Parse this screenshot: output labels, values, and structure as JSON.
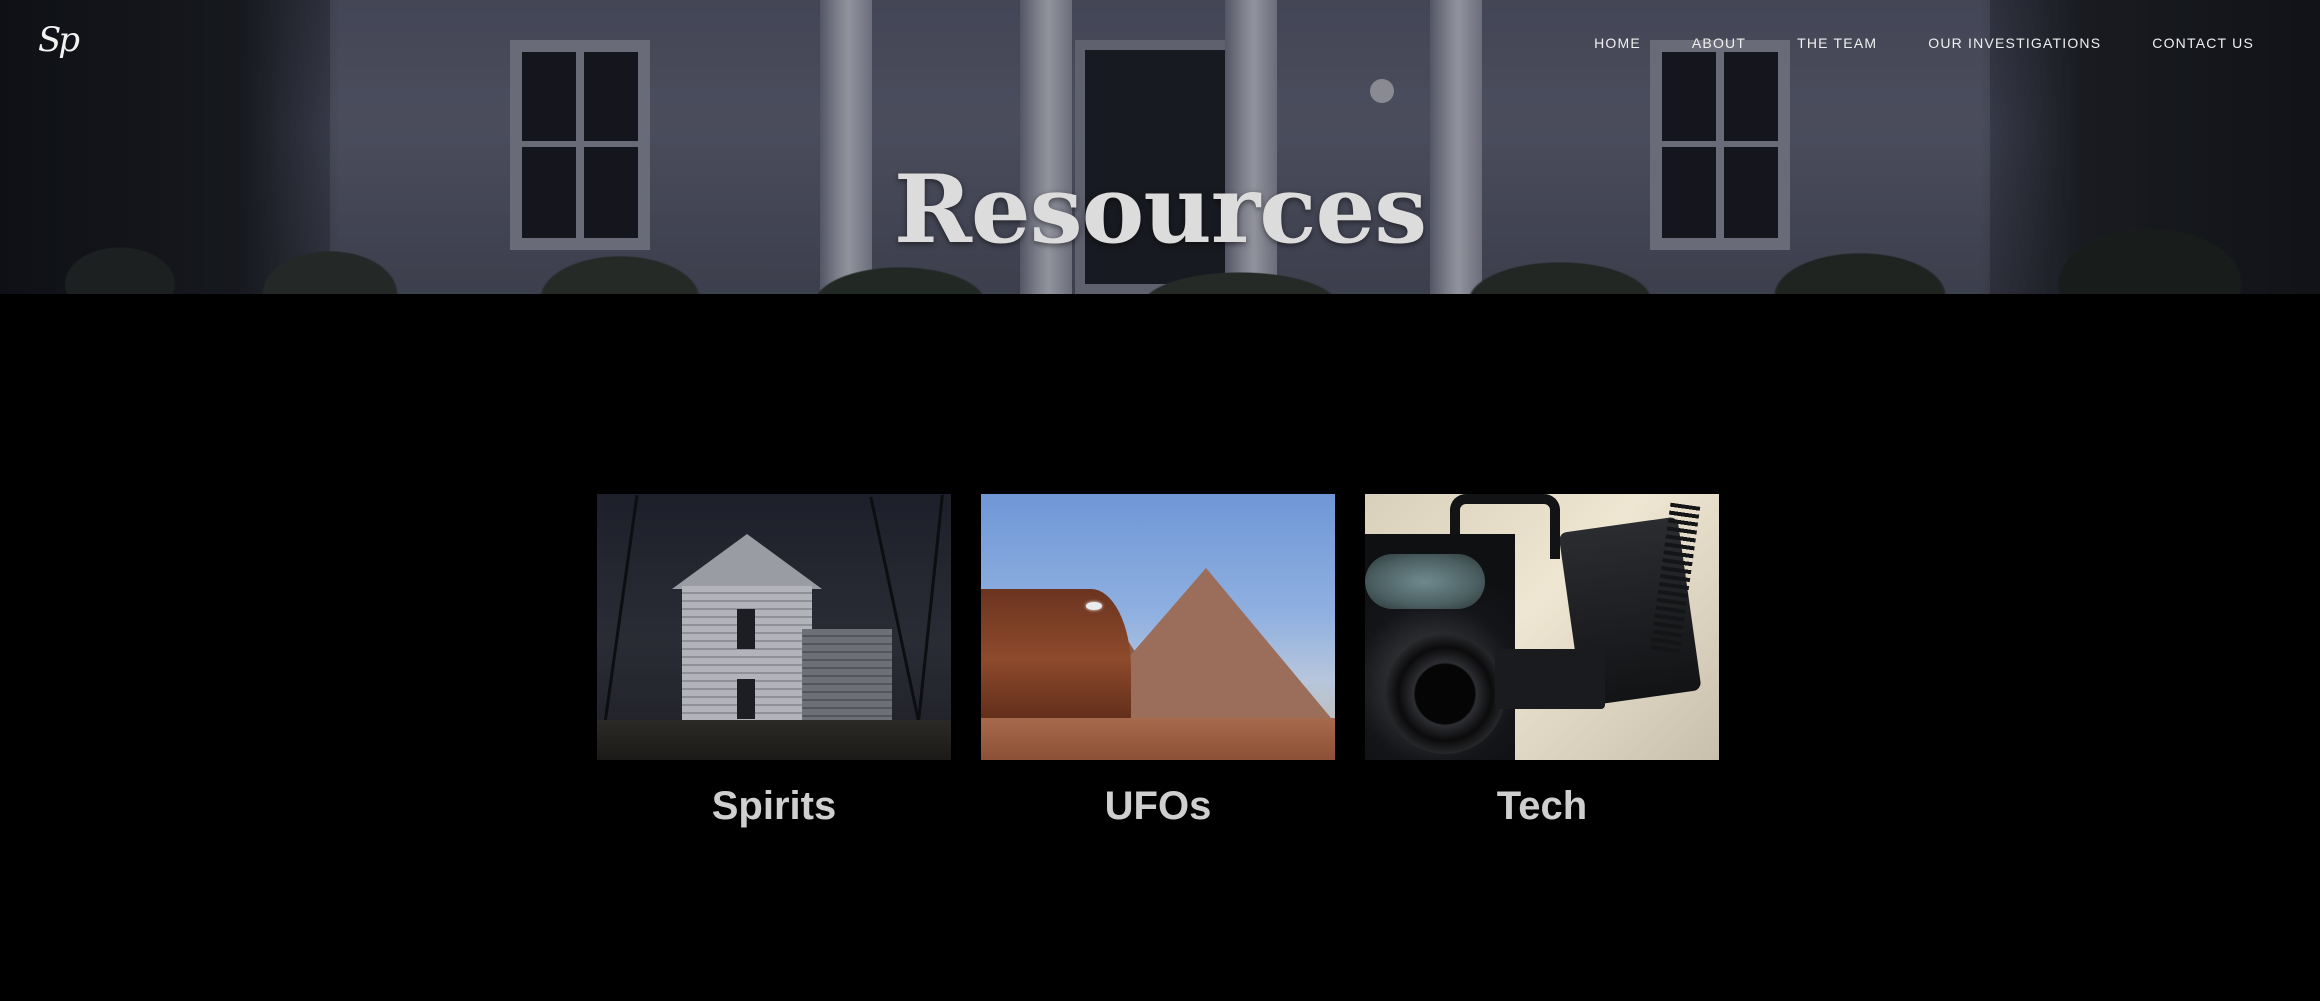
{
  "brand": {
    "logo_text": "Sp"
  },
  "nav": {
    "items": [
      {
        "label": "HOME"
      },
      {
        "label": "ABOUT"
      },
      {
        "label": "THE TEAM"
      },
      {
        "label": "OUR INVESTIGATIONS"
      },
      {
        "label": "CONTACT US"
      }
    ]
  },
  "hero": {
    "title": "Resources"
  },
  "cards": [
    {
      "title": "Spirits",
      "image": "haunted-house-photo"
    },
    {
      "title": "UFOs",
      "image": "desert-ufo-photo"
    },
    {
      "title": "Tech",
      "image": "video-camera-photo"
    }
  ],
  "colors": {
    "background": "#000000",
    "heading_text": "#cfcfcf",
    "nav_text": "#f0f0f0"
  }
}
